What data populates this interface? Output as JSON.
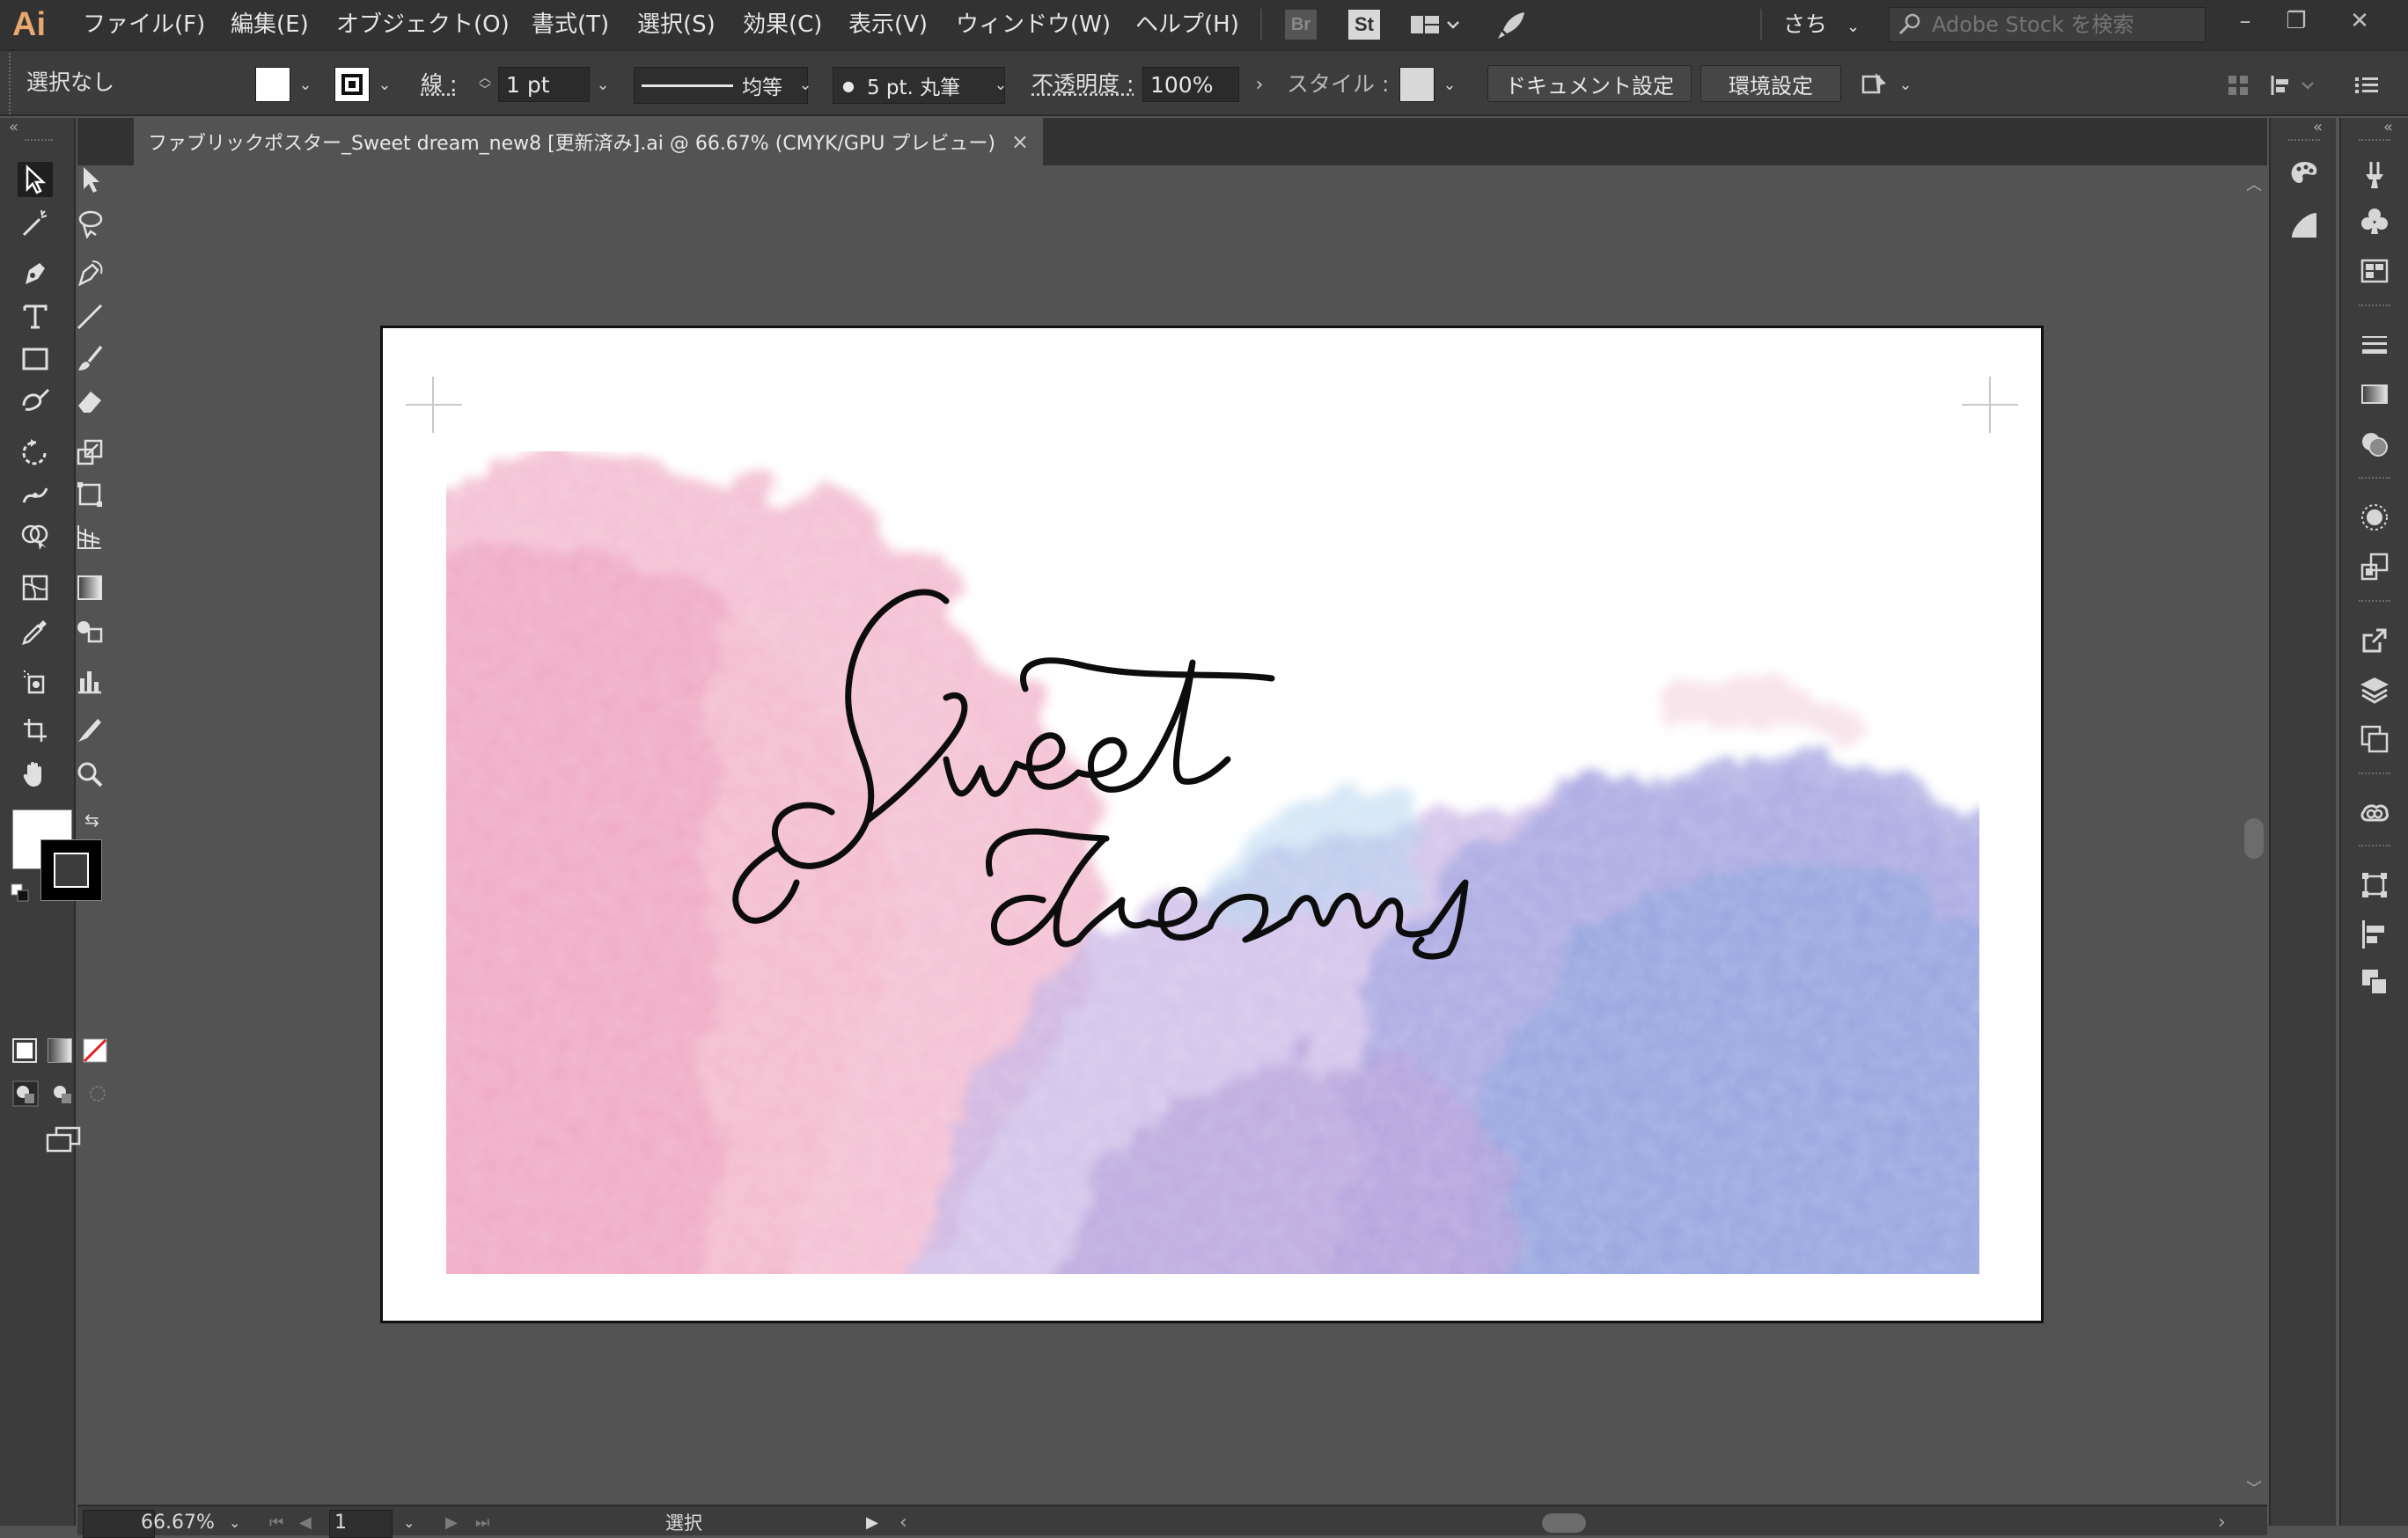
{
  "app": {
    "logo": "Ai"
  },
  "menu": [
    "ファイル(F)",
    "編集(E)",
    "オブジェクト(O)",
    "書式(T)",
    "選択(S)",
    "効果(C)",
    "表示(V)",
    "ウィンドウ(W)",
    "ヘルプ(H)"
  ],
  "topbar": {
    "bridge": "Br",
    "stock": "St",
    "workspace": "さち",
    "search_placeholder": "Adobe Stock を検索"
  },
  "control": {
    "selection": "選択なし",
    "stroke_label": "線 :",
    "stroke_weight": "1 pt",
    "profile_label": "均等",
    "brush_label": "5 pt. 丸筆",
    "opacity_label": "不透明度 :",
    "opacity_value": "100%",
    "style_label": "スタイル :",
    "doc_setup": "ドキュメント設定",
    "preferences": "環境設定"
  },
  "document": {
    "tab_title": "ファブリックポスター_Sweet dream_new8 [更新済み].ai @ 66.67% (CMYK/GPU プレビュー)",
    "close": "×"
  },
  "status": {
    "zoom": "66.67%",
    "page": "1",
    "tool": "選択"
  },
  "colors": {
    "fill": "#ffffff",
    "stroke": "#000000",
    "accent": "#e8a86e",
    "pink": "#ef9fbd",
    "lavender": "#8e8ed6"
  }
}
